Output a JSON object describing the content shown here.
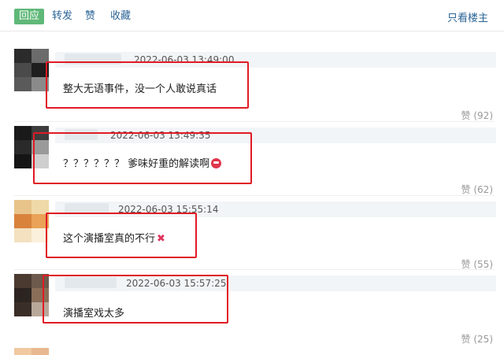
{
  "toolbar": {
    "reply_label": "回应",
    "repost_label": "转发",
    "like_label": "赞",
    "fav_label": "收藏",
    "only_op_label": "只看楼主"
  },
  "comments": [
    {
      "timestamp": "2022-06-03 13:49:00",
      "text": "整大无语事件，没一个人敢说真话",
      "likes": "赞 (92)"
    },
    {
      "timestamp": "2022-06-03 13:49:35",
      "text": "？？？？？？ 爹味好重的解读啊",
      "likes": "赞 (62)",
      "emoji": "red-face-emoji"
    },
    {
      "timestamp": "2022-06-03 15:55:14",
      "text": "这个演播室真的不行",
      "likes": "赞 (55)",
      "emoji": "x-mark-emoji"
    },
    {
      "timestamp": "2022-06-03 15:57:25",
      "text": "演播室戏太多",
      "likes": "赞 (25)"
    }
  ],
  "colors": {
    "accent_green": "#5fb878",
    "link_blue": "#2a6496",
    "highlight_red": "#e01b24"
  }
}
